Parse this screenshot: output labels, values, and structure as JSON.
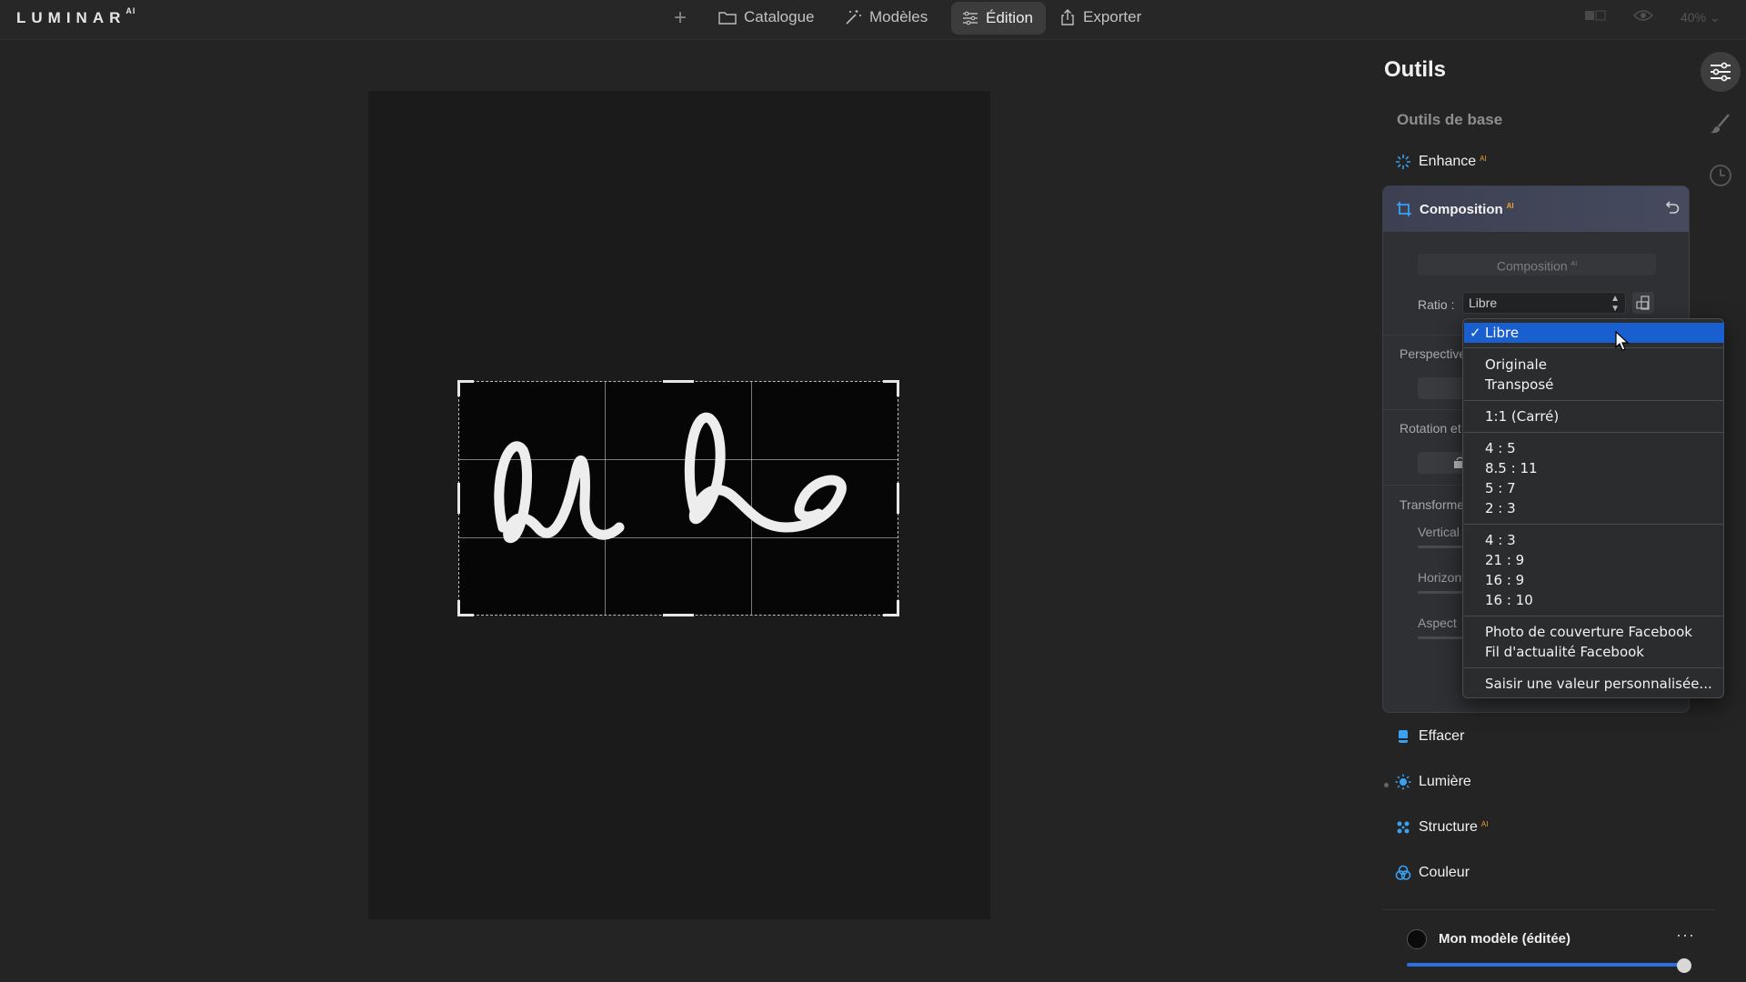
{
  "app": {
    "logo": "LUMINAR",
    "logo_suffix": "AI",
    "zoom": "40%"
  },
  "topbar": {
    "catalogue": "Catalogue",
    "modeles": "Modèles",
    "edition": "Édition",
    "exporter": "Exporter"
  },
  "panel": {
    "title": "Outils",
    "section": "Outils de base",
    "enhance": "Enhance",
    "ai_badge": "AI",
    "composition": {
      "title": "Composition",
      "button": "Composition",
      "ratio_label": "Ratio :",
      "ratio_value": "Libre",
      "perspective": "Perspective",
      "rotation": "Rotation et retournement",
      "transform": "Transformer",
      "vertical": "Vertical",
      "horizontal": "Horizontal",
      "aspect": "Aspect"
    },
    "effacer": "Effacer",
    "lumiere": "Lumière",
    "structure": "Structure",
    "couleur": "Couleur"
  },
  "dropdown": {
    "selected": "Libre",
    "group1": [
      "Originale",
      "Transposé"
    ],
    "group2": [
      "1:1 (Carré)"
    ],
    "group3": [
      "4 : 5",
      "8.5 : 11",
      "5 : 7",
      "2 : 3"
    ],
    "group4": [
      "4 : 3",
      "21 : 9",
      "16 : 9",
      "16 : 10"
    ],
    "group5": [
      "Photo de couverture Facebook",
      "Fil d'actualité Facebook"
    ],
    "custom": "Saisir une valeur personnalisée..."
  },
  "model": {
    "name": "Mon modèle (éditée)",
    "more": "···",
    "amount": 1.0
  },
  "colors": {
    "accent": "#1a5fd0",
    "ai_badge": "#f0a030",
    "icon_blue": "#3aa0f0"
  }
}
